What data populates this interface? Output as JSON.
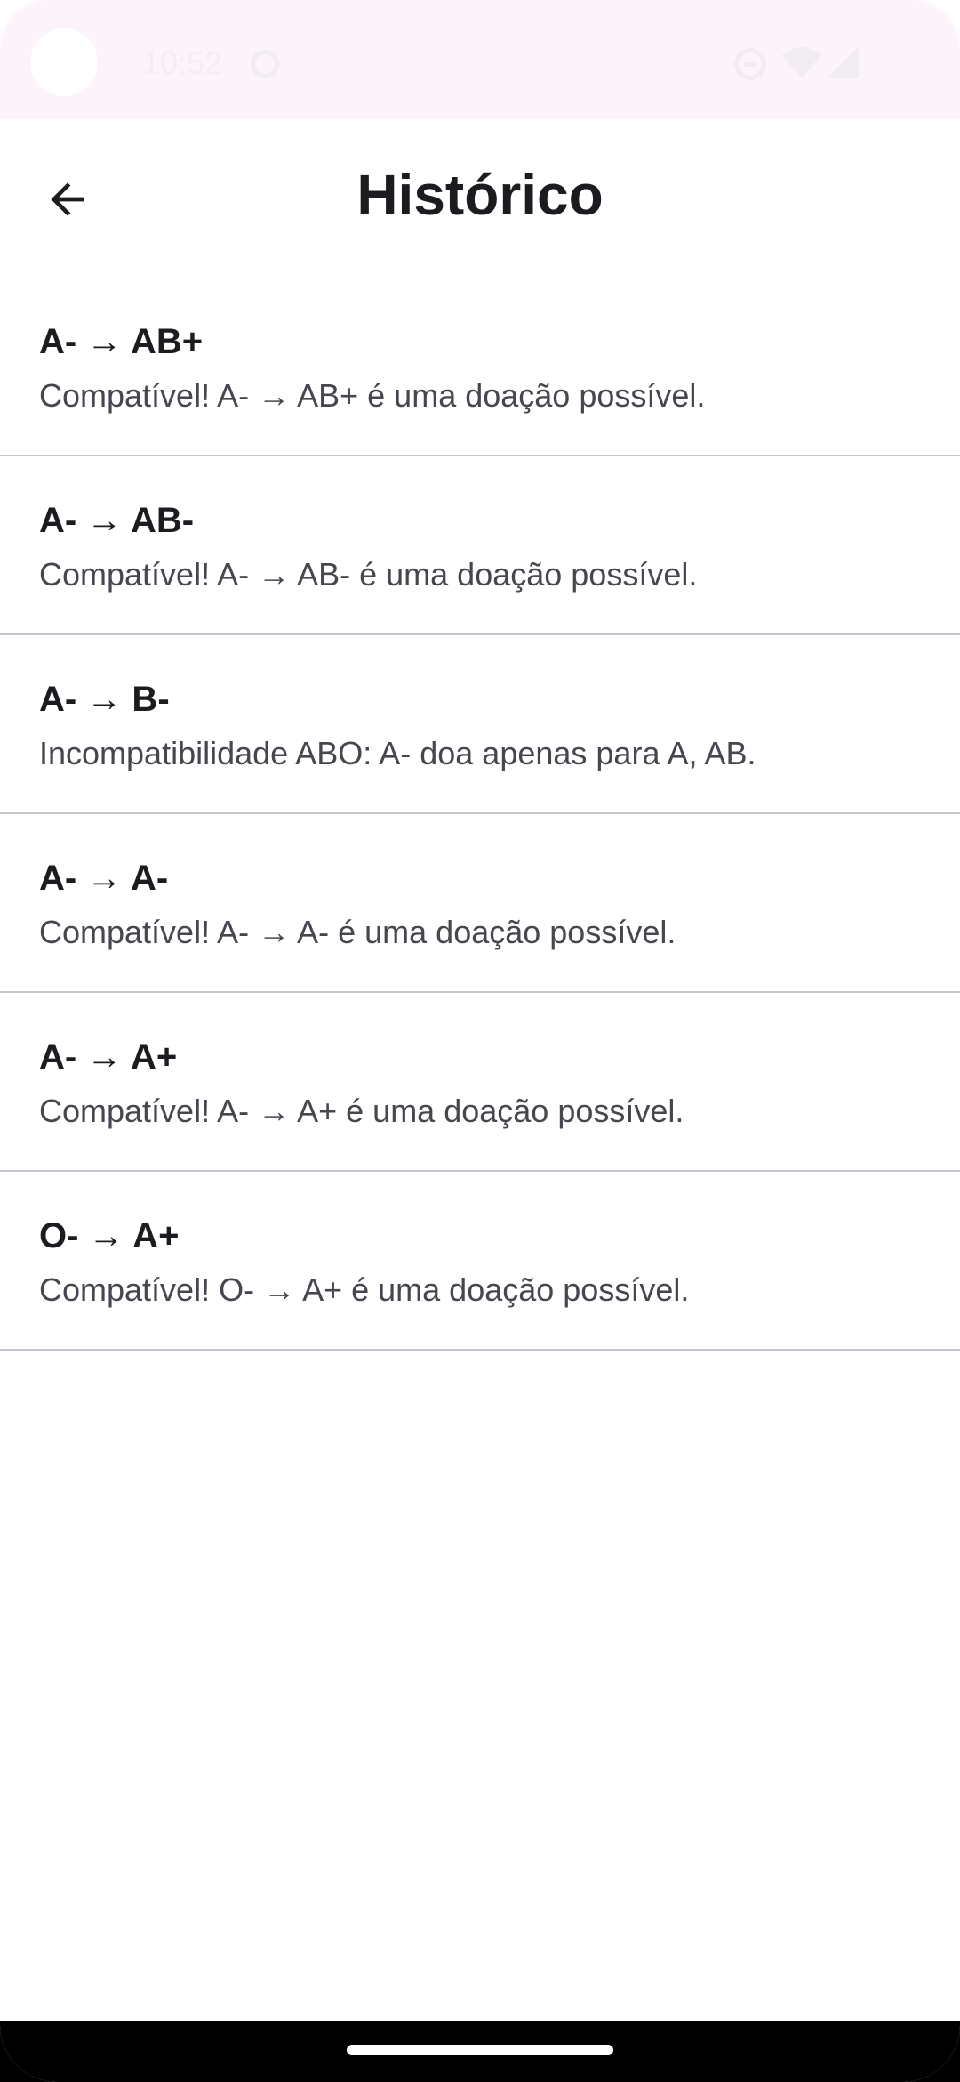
{
  "status_bar": {
    "time": "10:52",
    "icons": [
      "sync-icon",
      "do-not-disturb-icon",
      "wifi-icon",
      "signal-icon"
    ]
  },
  "app_bar": {
    "title": "Histórico",
    "back_icon": "arrow-left-icon"
  },
  "history": [
    {
      "title": "A- → AB+",
      "message": "Compatível! A- → AB+ é uma doação possível."
    },
    {
      "title": "A- → AB-",
      "message": "Compatível! A- → AB- é uma doação possível."
    },
    {
      "title": "A- → B-",
      "message": "Incompatibilidade ABO: A- doa apenas para A, AB."
    },
    {
      "title": "A- → A-",
      "message": "Compatível! A- → A- é uma doação possível."
    },
    {
      "title": "A- → A+",
      "message": "Compatível! A- → A+ é uma doação possível."
    },
    {
      "title": "O- → A+",
      "message": "Compatível! O- → A+ é uma doação possível."
    }
  ],
  "colors": {
    "status_bar_bg": "#fdf3fb",
    "title_text": "#1d1b20",
    "secondary_text": "#49454f",
    "divider": "#cac4d0"
  }
}
